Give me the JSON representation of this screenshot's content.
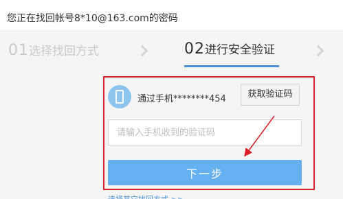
{
  "header": {
    "title": "您正在找回帐号8*10@163.com的密码"
  },
  "steps": [
    {
      "num": "01",
      "label": "选择找回方式",
      "state": "done"
    },
    {
      "num": "02",
      "label": "进行安全验证",
      "state": "active"
    }
  ],
  "verify": {
    "phone_icon": "mobile-phone-icon",
    "phone_text": "通过手机********454",
    "get_code_label": "获取验证码",
    "code_placeholder": "请输入手机收到的验证码",
    "code_value": "",
    "next_label": "下一步",
    "other_method_link": "选择其它找回方式 >>"
  },
  "colors": {
    "accent_blue": "#4a90d9",
    "button_blue": "#65b0ef",
    "highlight_red": "#d9202a"
  }
}
